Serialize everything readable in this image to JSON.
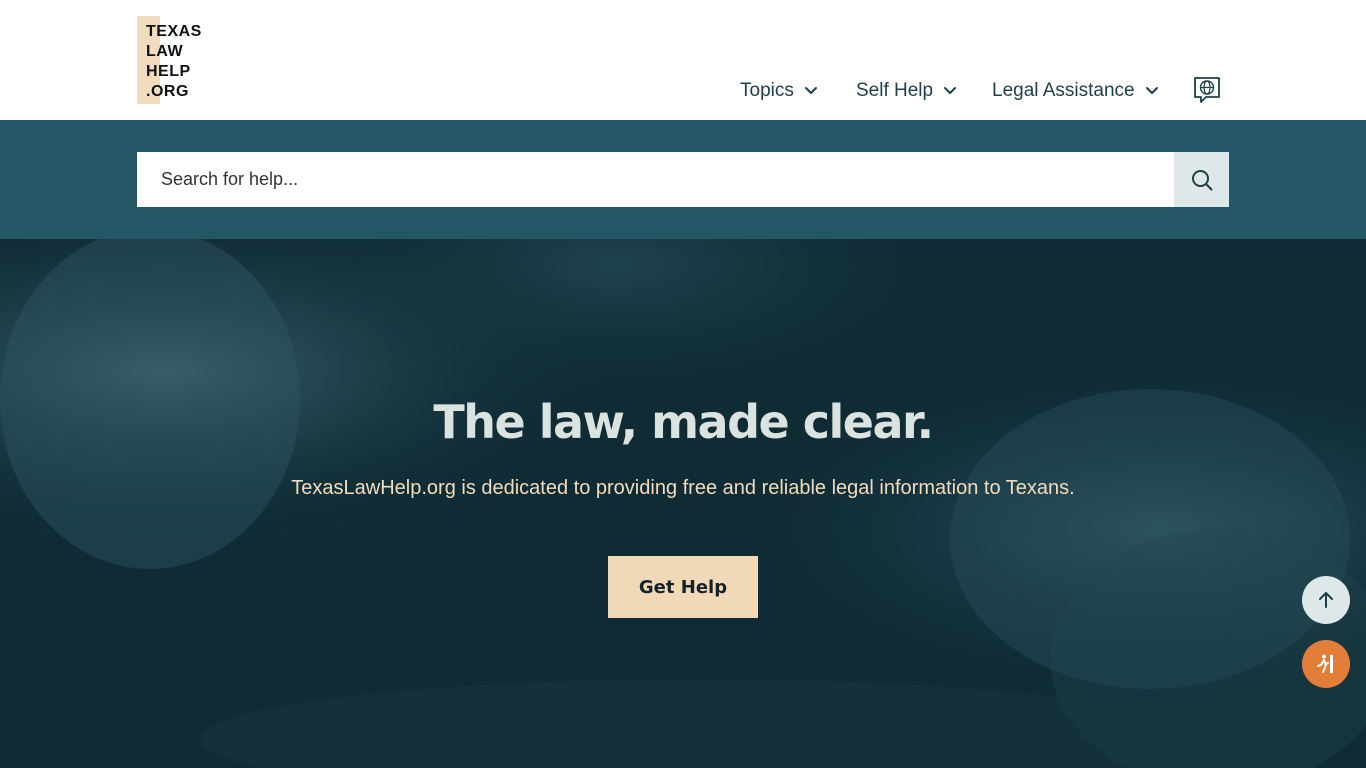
{
  "logo": {
    "lines": [
      "TEXAS",
      "LAW",
      "HELP",
      ".ORG"
    ],
    "accent": "#f2dcbd"
  },
  "nav": {
    "items": [
      {
        "label": "Topics",
        "icon": "chevron-down-icon"
      },
      {
        "label": "Self Help",
        "icon": "chevron-down-icon"
      },
      {
        "label": "Legal Assistance",
        "icon": "chevron-down-icon"
      }
    ],
    "language_icon": "globe-chat-icon"
  },
  "search": {
    "placeholder": "Search for help...",
    "value": "",
    "button_icon": "search-icon"
  },
  "hero": {
    "title": "The law, made clear.",
    "subtitle": "TexasLawHelp.org is dedicated to providing free and reliable legal information to Texans.",
    "cta_label": "Get Help"
  },
  "floating": {
    "scroll_top_icon": "arrow-up-icon",
    "quick_exit_icon": "running-person-icon"
  },
  "colors": {
    "brand_teal": "#235766",
    "hero_overlay": "#0f2b34",
    "cta_bg": "#f1d9b7",
    "quick_exit": "#e27d3a"
  }
}
